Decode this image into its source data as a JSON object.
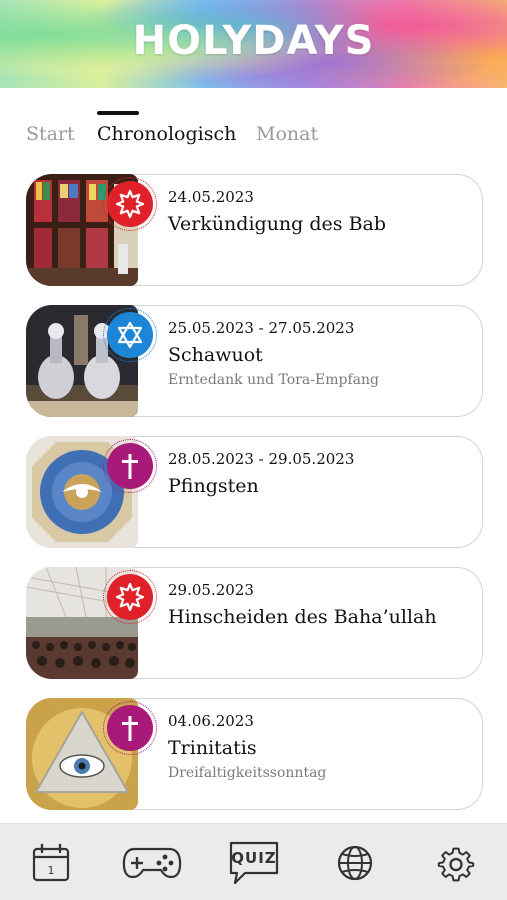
{
  "app": {
    "logo": "HOLYDAYS"
  },
  "tabs": [
    {
      "label": "Start",
      "active": false
    },
    {
      "label": "Chronologisch",
      "active": true
    },
    {
      "label": "Monat",
      "active": false
    }
  ],
  "events": [
    {
      "date": "24.05.2023",
      "title": "Verkündigung des Bab",
      "subtitle": "",
      "religion_icon": "bahai-star-icon",
      "badge_color": "#e0212a",
      "image": "stained-glass-interior"
    },
    {
      "date": "25.05.2023 - 27.05.2023",
      "title": "Schawuot",
      "subtitle": "Erntedank und Tora-Empfang",
      "religion_icon": "star-of-david-icon",
      "badge_color": "#1e86d6",
      "image": "torah-scrolls"
    },
    {
      "date": "28.05.2023 - 29.05.2023",
      "title": "Pfingsten",
      "subtitle": "",
      "religion_icon": "cross-icon",
      "badge_color": "#a8197a",
      "image": "dove-ceiling-mosaic"
    },
    {
      "date": "29.05.2023",
      "title": "Hinscheiden des Baha’ullah",
      "subtitle": "",
      "religion_icon": "bahai-star-icon",
      "badge_color": "#e0212a",
      "image": "assembly-hall"
    },
    {
      "date": "04.06.2023",
      "title": "Trinitatis",
      "subtitle": "Dreifaltigkeitssonntag",
      "religion_icon": "cross-icon",
      "badge_color": "#a8197a",
      "image": "eye-of-providence"
    }
  ],
  "bottom_nav": {
    "calendar_day": "1",
    "quiz_label": "QUIZ",
    "items": [
      "calendar-icon",
      "gamepad-icon",
      "quiz-icon",
      "globe-icon",
      "settings-gear-icon"
    ]
  }
}
